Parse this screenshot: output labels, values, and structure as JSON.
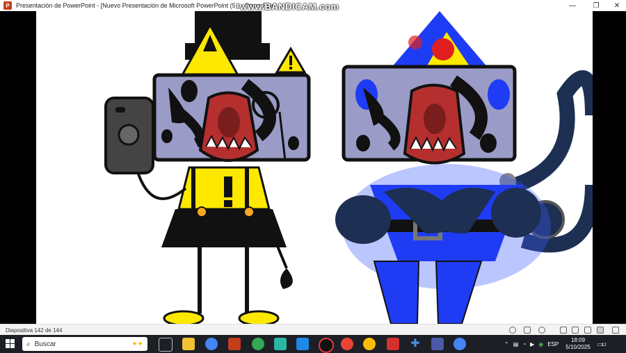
{
  "window": {
    "title": "Presentación de PowerPoint - [Nuevo Presentación de Microsoft PowerPoint (5)] - PowerPoint",
    "app_badge": "P",
    "watermark": "www.BANDICAM.com",
    "minimize": "—",
    "maximize": "❐",
    "close": "✕"
  },
  "statusbar": {
    "slide_info": "Diapositiva 142 de 144"
  },
  "taskbar": {
    "search_placeholder": "Buscar",
    "language": "ESP",
    "time": "18:09",
    "date": "5/10/2025",
    "notification_count": "12"
  },
  "colors": {
    "yellow": "#fde800",
    "blue": "#1f3cf5",
    "navy": "#1d2f52",
    "monitor": "#9a9cc7",
    "powerpoint": "#c43e1c",
    "taskbar": "#1d1f26"
  }
}
